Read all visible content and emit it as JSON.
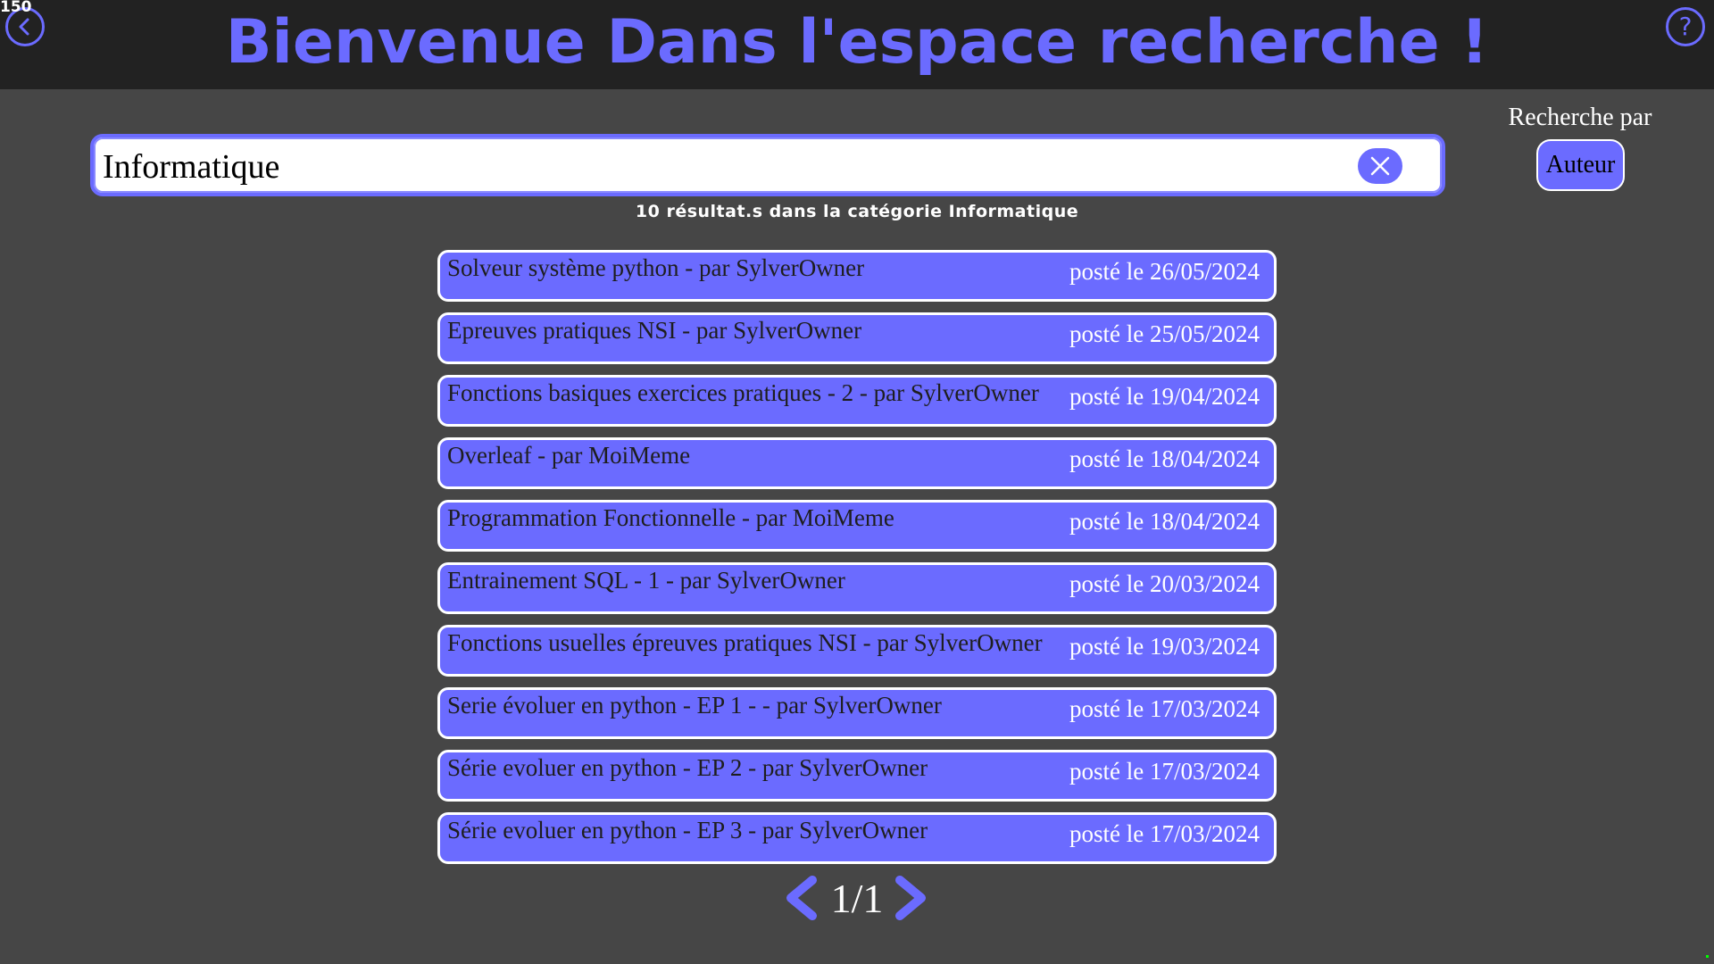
{
  "debug": {
    "fps": "150"
  },
  "header": {
    "title": "Bienvenue Dans l'espace recherche !",
    "back_icon": "chevron-left-icon",
    "help_label": "?",
    "accent_color": "#6b6bff"
  },
  "search": {
    "value": "Informatique",
    "clear_icon": "close-icon"
  },
  "search_by": {
    "label": "Recherche par",
    "button_label": "Auteur"
  },
  "results_summary": "10 résultat.s dans la catégorie Informatique",
  "results": [
    {
      "title": "Solveur système python - par SylverOwner",
      "date": "posté le 26/05/2024"
    },
    {
      "title": "Epreuves pratiques NSI - par SylverOwner",
      "date": "posté le 25/05/2024"
    },
    {
      "title": "Fonctions basiques exercices pratiques - 2 - par SylverOwner",
      "date": "posté le 19/04/2024"
    },
    {
      "title": "Overleaf - par MoiMeme",
      "date": "posté le 18/04/2024"
    },
    {
      "title": "Programmation Fonctionnelle - par MoiMeme",
      "date": "posté le 18/04/2024"
    },
    {
      "title": "Entrainement SQL - 1 - par SylverOwner",
      "date": "posté le 20/03/2024"
    },
    {
      "title": "Fonctions usuelles épreuves pratiques NSI - par SylverOwner",
      "date": "posté le 19/03/2024"
    },
    {
      "title": "Serie évoluer en python - EP 1 - - par SylverOwner",
      "date": "posté le 17/03/2024"
    },
    {
      "title": "Série evoluer en python - EP 2 - par SylverOwner",
      "date": "posté le 17/03/2024"
    },
    {
      "title": "Série evoluer en python - EP 3 - par SylverOwner",
      "date": "posté le 17/03/2024"
    }
  ],
  "pagination": {
    "label": "1/1",
    "prev_icon": "chevron-left-icon",
    "next_icon": "chevron-right-icon"
  }
}
